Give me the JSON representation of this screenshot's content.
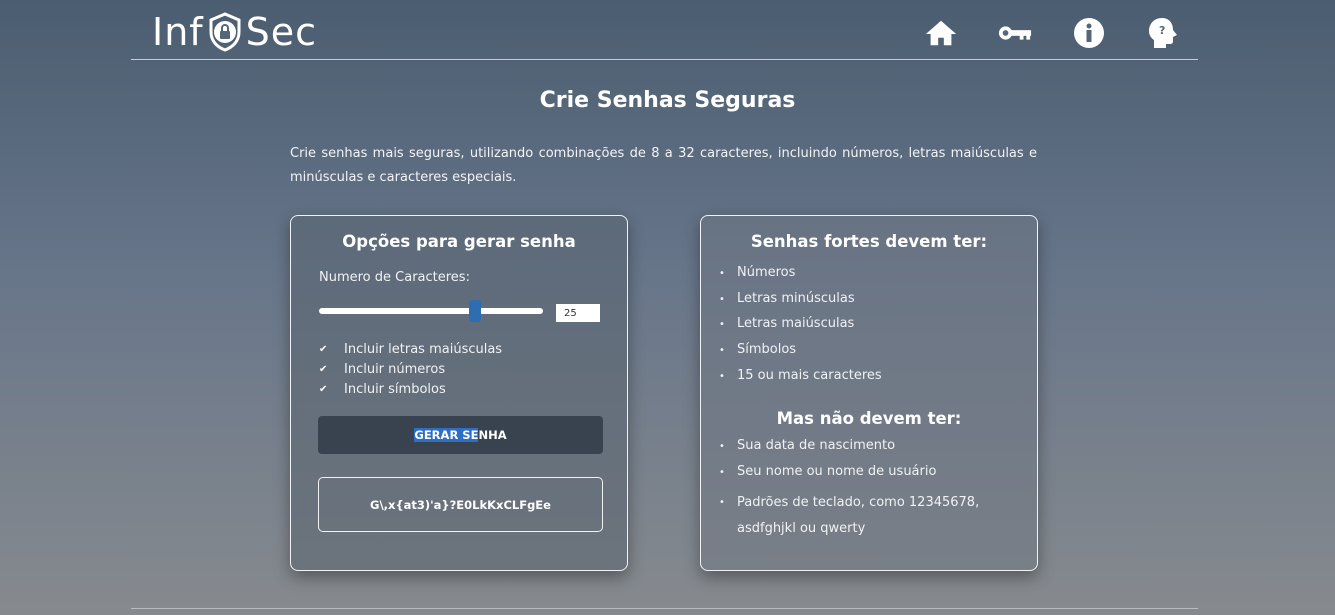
{
  "header": {
    "logo_left": "Inf",
    "logo_right": "Sec",
    "nav": [
      "home-icon",
      "key-icon",
      "info-icon",
      "help-icon"
    ]
  },
  "page_title": "Crie Senhas Seguras",
  "intro": "Crie senhas mais seguras, utilizando combinações de 8 a 32 caracteres, incluindo números, letras maiúsculas e minúsculas e caracteres especiais.",
  "generator": {
    "title": "Opções para gerar senha",
    "length_label": "Numero de Caracteres:",
    "length_value": "25",
    "slider": {
      "min": 8,
      "max": 32,
      "value": 25
    },
    "options": [
      {
        "label": "Incluir letras maiúsculas",
        "checked": true
      },
      {
        "label": "Incluir números",
        "checked": true
      },
      {
        "label": "Incluir símbolos",
        "checked": true
      }
    ],
    "button_selected": "GERAR SE",
    "button_rest": "NHA",
    "result": "G\\,x{at3)'a}?E0LkKxCLFgEe"
  },
  "tips": {
    "must_title": "Senhas fortes devem ter:",
    "must": [
      "Números",
      "Letras minúsculas",
      "Letras maiúsculas",
      "Símbolos",
      "15 ou mais caracteres"
    ],
    "must_not_title": "Mas não devem ter:",
    "must_not": [
      "Sua data de nascimento",
      "Seu nome ou nome de usuário",
      "Padrões de teclado, como 12345678, asdfghjkl ou qwerty"
    ]
  },
  "colors": {
    "button_bg": "#394350",
    "slider_thumb": "#2f6db3",
    "selection": "#2d6ec7"
  }
}
